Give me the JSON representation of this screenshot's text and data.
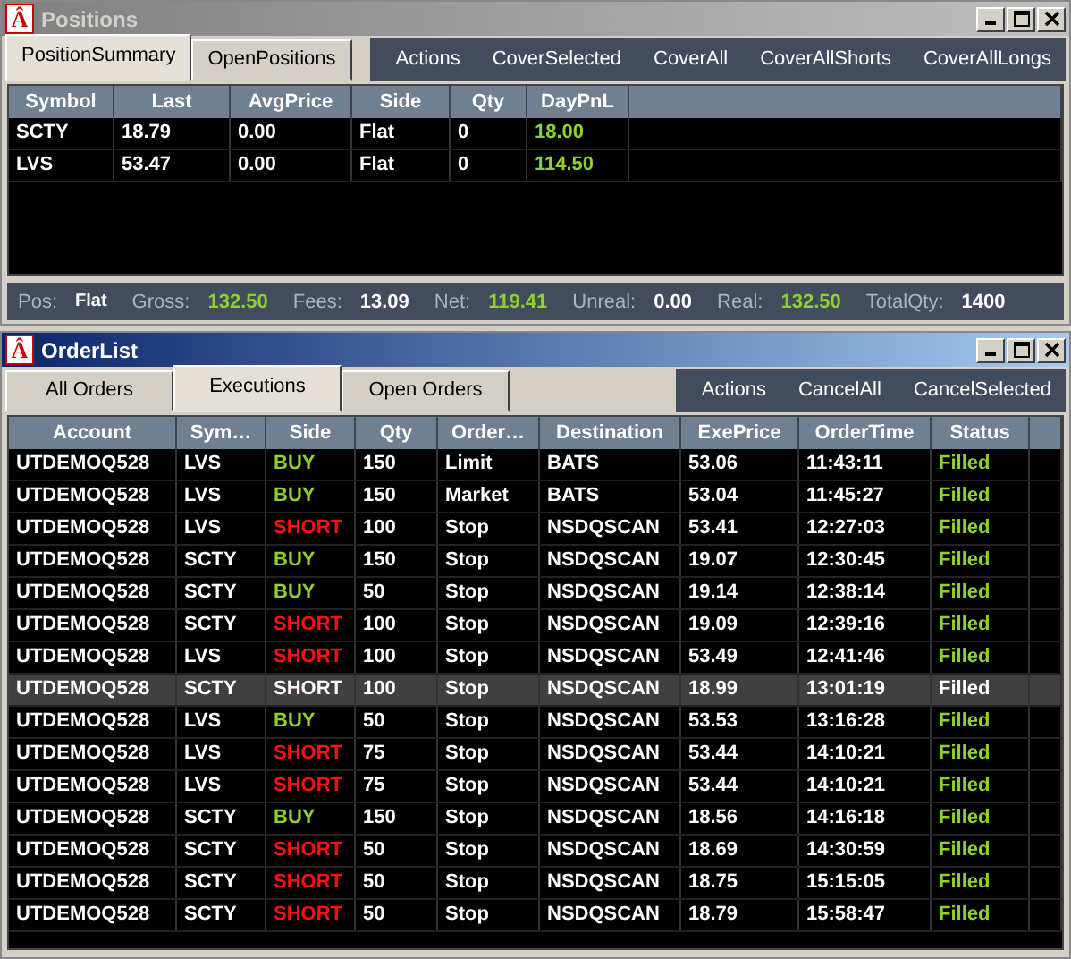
{
  "positions_window": {
    "logo": "Â",
    "title": "Positions",
    "active": false,
    "tabs": [
      {
        "label": "PositionSummary",
        "selected": true
      },
      {
        "label": "OpenPositions",
        "selected": false
      }
    ],
    "actions": [
      "Actions",
      "CoverSelected",
      "CoverAll",
      "CoverAllShorts",
      "CoverAllLongs"
    ],
    "table": {
      "columns": [
        "Symbol",
        "Last",
        "AvgPrice",
        "Side",
        "Qty",
        "DayPnL"
      ],
      "rows": [
        [
          "SCTY",
          "18.79",
          "0.00",
          "Flat",
          "0",
          "18.00"
        ],
        [
          "LVS",
          "53.47",
          "0.00",
          "Flat",
          "0",
          "114.50"
        ]
      ]
    },
    "status_bar": [
      {
        "label": "Pos:",
        "value": "Flat",
        "positive": false
      },
      {
        "label": "Gross:",
        "value": "132.50",
        "positive": true
      },
      {
        "label": "Fees:",
        "value": "13.09",
        "positive": false
      },
      {
        "label": "Net:",
        "value": "119.41",
        "positive": true
      },
      {
        "label": "Unreal:",
        "value": "0.00",
        "positive": false
      },
      {
        "label": "Real:",
        "value": "132.50",
        "positive": true
      },
      {
        "label": "TotalQty:",
        "value": "1400",
        "positive": false
      }
    ]
  },
  "orders_window": {
    "logo": "Â",
    "title": "OrderList",
    "active": true,
    "tabs": [
      {
        "label": "All Orders",
        "selected": false
      },
      {
        "label": "Executions",
        "selected": true
      },
      {
        "label": "Open Orders",
        "selected": false
      }
    ],
    "actions": [
      "Actions",
      "CancelAll",
      "CancelSelected"
    ],
    "table": {
      "columns": [
        "Account",
        "Sym…",
        "Side",
        "Qty",
        "Order…",
        "Destination",
        "ExePrice",
        "OrderTime",
        "Status"
      ],
      "rows": [
        {
          "kind": "buy",
          "selected": false,
          "cells": [
            "UTDEMOQ528",
            "LVS",
            "BUY",
            "150",
            "Limit",
            "BATS",
            "53.06",
            "11:43:11",
            "Filled"
          ]
        },
        {
          "kind": "buy",
          "selected": false,
          "cells": [
            "UTDEMOQ528",
            "LVS",
            "BUY",
            "150",
            "Market",
            "BATS",
            "53.04",
            "11:45:27",
            "Filled"
          ]
        },
        {
          "kind": "short",
          "selected": false,
          "cells": [
            "UTDEMOQ528",
            "LVS",
            "SHORT",
            "100",
            "Stop",
            "NSDQSCAN",
            "53.41",
            "12:27:03",
            "Filled"
          ]
        },
        {
          "kind": "buy",
          "selected": false,
          "cells": [
            "UTDEMOQ528",
            "SCTY",
            "BUY",
            "150",
            "Stop",
            "NSDQSCAN",
            "19.07",
            "12:30:45",
            "Filled"
          ]
        },
        {
          "kind": "buy",
          "selected": false,
          "cells": [
            "UTDEMOQ528",
            "SCTY",
            "BUY",
            "50",
            "Stop",
            "NSDQSCAN",
            "19.14",
            "12:38:14",
            "Filled"
          ]
        },
        {
          "kind": "short",
          "selected": false,
          "cells": [
            "UTDEMOQ528",
            "SCTY",
            "SHORT",
            "100",
            "Stop",
            "NSDQSCAN",
            "19.09",
            "12:39:16",
            "Filled"
          ]
        },
        {
          "kind": "short",
          "selected": false,
          "cells": [
            "UTDEMOQ528",
            "LVS",
            "SHORT",
            "100",
            "Stop",
            "NSDQSCAN",
            "53.49",
            "12:41:46",
            "Filled"
          ]
        },
        {
          "kind": "short",
          "selected": true,
          "cells": [
            "UTDEMOQ528",
            "SCTY",
            "SHORT",
            "100",
            "Stop",
            "NSDQSCAN",
            "18.99",
            "13:01:19",
            "Filled"
          ]
        },
        {
          "kind": "buy",
          "selected": false,
          "cells": [
            "UTDEMOQ528",
            "LVS",
            "BUY",
            "50",
            "Stop",
            "NSDQSCAN",
            "53.53",
            "13:16:28",
            "Filled"
          ]
        },
        {
          "kind": "short",
          "selected": false,
          "cells": [
            "UTDEMOQ528",
            "LVS",
            "SHORT",
            "75",
            "Stop",
            "NSDQSCAN",
            "53.44",
            "14:10:21",
            "Filled"
          ]
        },
        {
          "kind": "short",
          "selected": false,
          "cells": [
            "UTDEMOQ528",
            "LVS",
            "SHORT",
            "75",
            "Stop",
            "NSDQSCAN",
            "53.44",
            "14:10:21",
            "Filled"
          ]
        },
        {
          "kind": "buy",
          "selected": false,
          "cells": [
            "UTDEMOQ528",
            "SCTY",
            "BUY",
            "150",
            "Stop",
            "NSDQSCAN",
            "18.56",
            "14:16:18",
            "Filled"
          ]
        },
        {
          "kind": "short",
          "selected": false,
          "cells": [
            "UTDEMOQ528",
            "SCTY",
            "SHORT",
            "50",
            "Stop",
            "NSDQSCAN",
            "18.69",
            "14:30:59",
            "Filled"
          ]
        },
        {
          "kind": "short",
          "selected": false,
          "cells": [
            "UTDEMOQ528",
            "SCTY",
            "SHORT",
            "50",
            "Stop",
            "NSDQSCAN",
            "18.75",
            "15:15:05",
            "Filled"
          ]
        },
        {
          "kind": "short",
          "selected": false,
          "cells": [
            "UTDEMOQ528",
            "SCTY",
            "SHORT",
            "50",
            "Stop",
            "NSDQSCAN",
            "18.79",
            "15:58:47",
            "Filled"
          ]
        }
      ]
    }
  }
}
